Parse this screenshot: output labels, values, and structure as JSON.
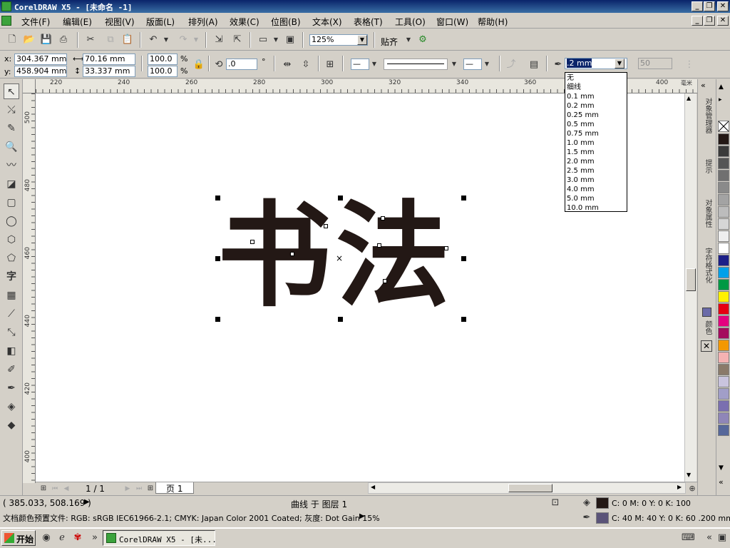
{
  "window": {
    "title": "CorelDRAW X5 - [未命名 -1]",
    "min_label": "_",
    "max_label": "❐",
    "close_label": "✕"
  },
  "menu": [
    "文件(F)",
    "编辑(E)",
    "视图(V)",
    "版面(L)",
    "排列(A)",
    "效果(C)",
    "位图(B)",
    "文本(X)",
    "表格(T)",
    "工具(O)",
    "窗口(W)",
    "帮助(H)"
  ],
  "toolbar": {
    "zoom_value": "125%",
    "snap_label": "贴齐"
  },
  "property_bar": {
    "x_label": "x:",
    "x_value": "304.367 mm",
    "y_label": "y:",
    "y_value": "458.904 mm",
    "width_value": "70.16 mm",
    "height_value": "33.337 mm",
    "scale_x": "100.0",
    "scale_y": "100.0",
    "percent": "%",
    "rotation_value": ".0",
    "degree": "°",
    "outline_width": ".2 mm",
    "miter_value": "50"
  },
  "outline_options": [
    "无",
    "细线",
    "0.1 mm",
    "0.2 mm",
    "0.25 mm",
    "0.5 mm",
    "0.75 mm",
    "1.0 mm",
    "1.5 mm",
    "2.0 mm",
    "2.5 mm",
    "3.0 mm",
    "4.0 mm",
    "5.0 mm",
    "10.0 mm"
  ],
  "rulers": {
    "unit": "毫米",
    "h_ticks": [
      "220",
      "240",
      "260",
      "280",
      "300",
      "320",
      "340",
      "360",
      "380",
      "400"
    ],
    "v_ticks": [
      "500",
      "480",
      "460",
      "440",
      "420",
      "400"
    ]
  },
  "canvas": {
    "art_text": "书法",
    "art_color": "#231815"
  },
  "page_nav": {
    "page_count": "1 / 1",
    "page_tab": "页 1"
  },
  "dockers": {
    "tab1": "对象管理器",
    "tab2": "提示",
    "tab3": "对象属性",
    "tab4": "字符格式化",
    "tab5": "颜色"
  },
  "palette_colors": [
    "#231815",
    "#3a3a3a",
    "#555555",
    "#707070",
    "#8a8a8a",
    "#a3a3a3",
    "#bcbcbc",
    "#d6d6d6",
    "#eeeeee",
    "#ffffff",
    "#1d2088",
    "#00a0e9",
    "#009944",
    "#fff100",
    "#e60012",
    "#e4007f",
    "#a40b5d",
    "#f39800",
    "#f5b2b2",
    "#8a7a6a",
    "#c9c4de",
    "#a19ec8",
    "#7a6fb0",
    "#8f86b8",
    "#56679a"
  ],
  "status": {
    "coords": "( 385.033, 508.169 )",
    "object_info": "曲线 于 图层 1",
    "fill_info": "C: 0 M: 0 Y: 0 K: 100",
    "outline_info": "C: 40 M: 40 Y: 0 K: 60  .200 mm",
    "doc_profile": "文档颜色预置文件: RGB: sRGB IEC61966-2.1; CMYK: Japan Color 2001 Coated; 灰度: Dot Gain 15%",
    "fill_color": "#231815",
    "outline_color": "#5a5378"
  },
  "taskbar": {
    "start_label": "开始",
    "task_label": "CorelDRAW X5 - [未..."
  }
}
